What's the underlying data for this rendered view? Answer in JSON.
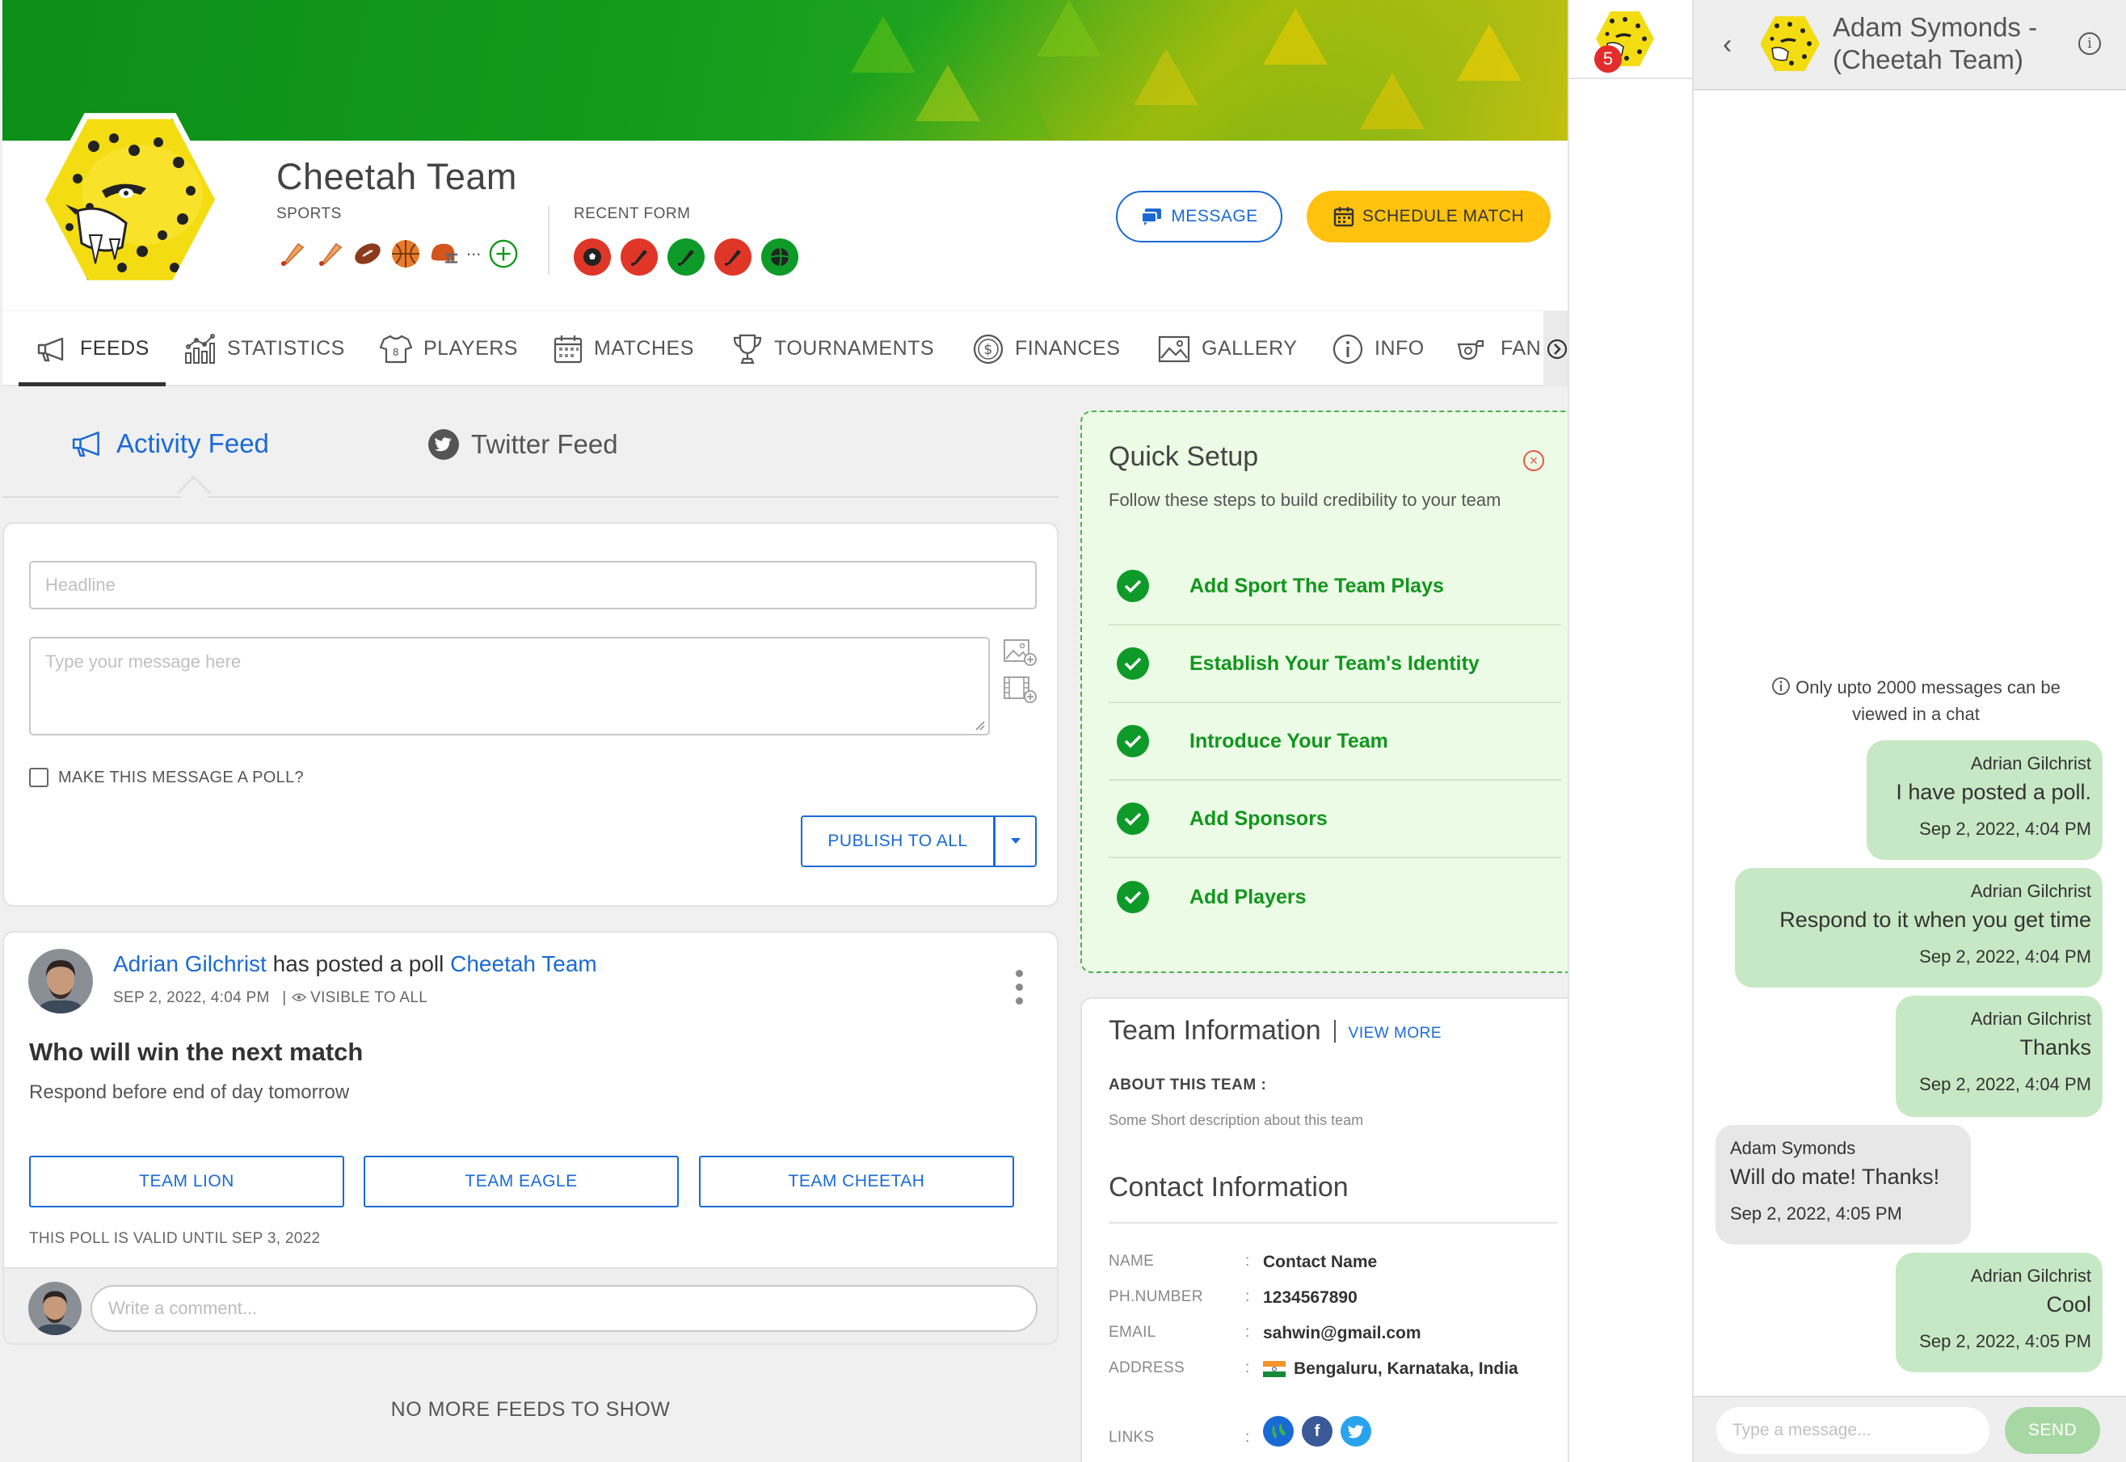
{
  "colors": {
    "brand_green": "#12961e",
    "accent_blue": "#1a6ad6",
    "cta_yellow": "#ffc20e",
    "badge_red": "#e32d2d",
    "bubble_out": "#c7e8c4",
    "bubble_in": "#e7e7e7"
  },
  "team": {
    "name": "Cheetah Team",
    "sports_label": "SPORTS",
    "recent_form_label": "RECENT FORM",
    "sports_icons": [
      "cricket-bat-icon",
      "cricket-bat-icon",
      "american-football-icon",
      "basketball-icon",
      "football-helmet-icon"
    ],
    "sports_more": "...",
    "add_sport_icon": "plus-circle-icon"
  },
  "recent_form": [
    {
      "icon": "soccer-ball-icon",
      "color": "#e03628"
    },
    {
      "icon": "cricket-bat-icon",
      "color": "#e03628"
    },
    {
      "icon": "cricket-bat-icon",
      "color": "#0e9a28"
    },
    {
      "icon": "cricket-bat-icon",
      "color": "#e03628"
    },
    {
      "icon": "volleyball-icon",
      "color": "#0e9a28"
    }
  ],
  "actions": {
    "message": "MESSAGE",
    "schedule": "SCHEDULE MATCH"
  },
  "tabs": [
    {
      "label": "FEEDS",
      "icon": "megaphone-icon"
    },
    {
      "label": "STATISTICS",
      "icon": "stats-icon"
    },
    {
      "label": "PLAYERS",
      "icon": "jersey-icon"
    },
    {
      "label": "MATCHES",
      "icon": "calendar-icon"
    },
    {
      "label": "TOURNAMENTS",
      "icon": "trophy-icon"
    },
    {
      "label": "FINANCES",
      "icon": "dollar-icon"
    },
    {
      "label": "GALLERY",
      "icon": "image-icon"
    },
    {
      "label": "INFO",
      "icon": "info-icon"
    },
    {
      "label": "FAN",
      "icon": "whistle-icon"
    }
  ],
  "feed_tabs": {
    "activity": "Activity Feed",
    "twitter": "Twitter Feed"
  },
  "compose": {
    "headline_placeholder": "Headline",
    "message_placeholder": "Type your message here",
    "poll_label": "MAKE THIS MESSAGE A POLL?",
    "publish": "PUBLISH TO ALL"
  },
  "post": {
    "author": "Adrian Gilchrist",
    "action": "has posted a poll",
    "target": "Cheetah Team",
    "date": "SEP 2, 2022, 4:04 PM",
    "visibility": "VISIBLE TO ALL",
    "question": "Who will win the next match",
    "subtitle": "Respond before end of day tomorrow",
    "options": [
      "TEAM LION",
      "TEAM EAGLE",
      "TEAM CHEETAH"
    ],
    "valid": "THIS POLL IS VALID UNTIL SEP 3, 2022",
    "comment_placeholder": "Write a comment..."
  },
  "no_more": "NO MORE FEEDS TO SHOW",
  "quick_setup": {
    "title": "Quick Setup",
    "desc": "Follow these steps to build credibility to your team",
    "items": [
      "Add Sport The Team Plays",
      "Establish Your Team's Identity",
      "Introduce Your Team",
      "Add Sponsors",
      "Add Players"
    ]
  },
  "team_info": {
    "title": "Team Information",
    "view_more": "VIEW MORE",
    "about_label": "ABOUT THIS TEAM :",
    "about_text": "Some Short description about this team"
  },
  "contact": {
    "title": "Contact Information",
    "rows": [
      {
        "label": "NAME",
        "value": "Contact Name"
      },
      {
        "label": "PH.NUMBER",
        "value": "1234567890"
      },
      {
        "label": "EMAIL",
        "value": "sahwin@gmail.com"
      },
      {
        "label": "ADDRESS",
        "value": "Bengaluru, Karnataka, India"
      }
    ],
    "links_label": "LINKS",
    "links": [
      "globe-icon",
      "facebook-icon",
      "twitter-icon"
    ]
  },
  "strip": {
    "badge": "5"
  },
  "chat": {
    "title": "Adam Symonds - (Cheetah Team)",
    "notice": "Only upto 2000 messages can be viewed in a chat",
    "messages": [
      {
        "dir": "out",
        "author": "Adrian Gilchrist",
        "text": "I have posted a poll.",
        "time": "Sep 2, 2022, 4:04 PM"
      },
      {
        "dir": "out",
        "author": "Adrian Gilchrist",
        "text": "Respond to it when you get time",
        "time": "Sep 2, 2022, 4:04 PM"
      },
      {
        "dir": "out",
        "author": "Adrian Gilchrist",
        "text": "Thanks",
        "time": "Sep 2, 2022, 4:04 PM"
      },
      {
        "dir": "in",
        "author": "Adam Symonds",
        "text": "Will do mate! Thanks!",
        "time": "Sep 2, 2022, 4:05 PM"
      },
      {
        "dir": "out",
        "author": "Adrian Gilchrist",
        "text": "Cool",
        "time": "Sep 2, 2022, 4:05 PM"
      }
    ],
    "input_placeholder": "Type a message...",
    "send": "SEND"
  }
}
